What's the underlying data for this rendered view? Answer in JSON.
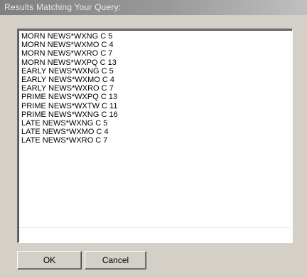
{
  "window": {
    "title": "Results Matching Your Query:"
  },
  "results": {
    "items": [
      "MORN NEWS*WXNG C 5",
      "MORN NEWS*WXMO C 4",
      "MORN NEWS*WXRO C 7",
      "MORN NEWS*WXPQ C 13",
      "EARLY NEWS*WXNG C 5",
      "EARLY NEWS*WXMO C 4",
      "EARLY NEWS*WXRO C 7",
      "PRIME NEWS*WXPQ C 13",
      "PRIME NEWS*WXTW C 11",
      "PRIME NEWS*WXNG C 16",
      "LATE NEWS*WXNG C 5",
      "LATE NEWS*WXMO C 4",
      "LATE NEWS*WXRO C 7"
    ]
  },
  "buttons": {
    "ok_label": "OK",
    "cancel_label": "Cancel"
  }
}
